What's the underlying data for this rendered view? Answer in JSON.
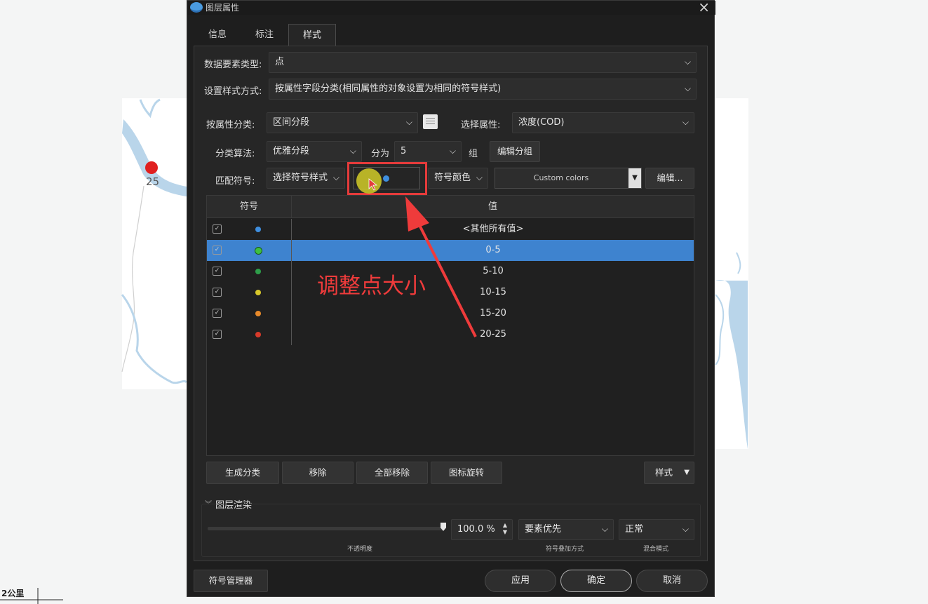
{
  "map": {
    "point_label": "25",
    "scale_label": "2公里"
  },
  "dialog": {
    "title": "图层属性",
    "tabs": [
      "信息",
      "标注",
      "样式"
    ],
    "feature_type_label": "数据要素类型:",
    "feature_type_value": "点",
    "style_mode_label": "设置样式方式:",
    "style_mode_value": "按属性字段分类(相同属性的对象设置为相同的符号样式)",
    "classify_by_label": "按属性分类:",
    "classify_by_value": "区间分段",
    "select_attr_label": "选择属性:",
    "select_attr_value": "浓度(COD)",
    "algorithm_label": "分类算法:",
    "algorithm_value": "优雅分段",
    "split_label": "分为",
    "split_value": "5",
    "group_unit": "组",
    "edit_group_button": "编辑分组",
    "match_symbol_label": "匹配符号:",
    "symbol_style_value": "选择符号样式",
    "symbol_color_value": "符号颜色",
    "color_ramp_value": "Custom colors",
    "edit_button": "编辑...",
    "table": {
      "columns": [
        "符号",
        "值"
      ],
      "rows": [
        {
          "value": "<其他所有值>",
          "color": "#3f8fe0",
          "checked": true
        },
        {
          "value": "0-5",
          "color": "#3fbf3f",
          "checked": true
        },
        {
          "value": "5-10",
          "color": "#2e9e4a",
          "checked": true
        },
        {
          "value": "10-15",
          "color": "#d8c82a",
          "checked": true
        },
        {
          "value": "15-20",
          "color": "#e88a2a",
          "checked": true
        },
        {
          "value": "20-25",
          "color": "#d83a2a",
          "checked": true
        }
      ],
      "selected_row_index": 1
    },
    "actions": {
      "generate": "生成分类",
      "remove": "移除",
      "remove_all": "全部移除",
      "icon_rotate": "图标旋转",
      "style": "样式"
    },
    "render_section": {
      "title": "图层渲染",
      "opacity_value": "100.0 %",
      "opacity_fraction": 1.0,
      "opacity_caption": "不透明度",
      "symbol_order_value": "要素优先",
      "symbol_order_caption": "符号叠加方式",
      "blend_value": "正常",
      "blend_caption": "混合模式"
    },
    "footer": {
      "symbol_manager": "符号管理器",
      "apply": "应用",
      "ok": "确定",
      "cancel": "取消"
    }
  },
  "annotation": {
    "text": "调整点大小",
    "color": "#ef3b3b"
  }
}
